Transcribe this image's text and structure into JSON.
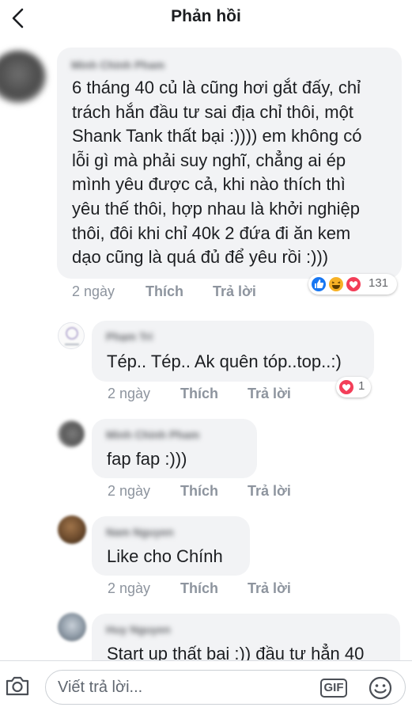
{
  "header": {
    "title": "Phản hồi"
  },
  "comments": [
    {
      "name": "Minh Chinh Pham",
      "lines": [
        "6 tháng 40 củ là cũng hơi gắt đấy, chỉ",
        "trách hắn đầu tư sai địa chỉ thôi, một",
        "Shank Tank thất bại :)))) em không có",
        "lỗi gì mà phải suy nghĩ, chẳng ai ép",
        "mình yêu được cả, khi nào thích thì",
        "yêu thế thôi, hợp nhau là khởi nghiệp",
        "thôi, đôi khi chỉ 40k 2 đứa đi ăn kem",
        "dạo cũng là quá đủ để yêu rồi :)))"
      ],
      "time": "2 ngày",
      "like": "Thích",
      "reply": "Trả lời",
      "reaction_count": "131",
      "reaction_types": [
        "like-icon",
        "haha-icon",
        "love-icon"
      ]
    },
    {
      "name": "Phạm Trí",
      "lines": [
        "Tép.. Tép.. Ak quên tóp..top..:)"
      ],
      "time": "2 ngày",
      "like": "Thích",
      "reply": "Trả lời",
      "reaction_count": "1",
      "reaction_types": [
        "love-icon"
      ]
    },
    {
      "name": "Minh Chinh Pham",
      "lines": [
        "fap fap :)))"
      ],
      "time": "2 ngày",
      "like": "Thích",
      "reply": "Trả lời"
    },
    {
      "name": "Nam Nguyen",
      "lines": [
        "Like cho Chính"
      ],
      "time": "2 ngày",
      "like": "Thích",
      "reply": "Trả lời"
    },
    {
      "name": "Huy Nguyen",
      "lines": [
        "Start up thất bại :)) đầu tư hẳn 40"
      ]
    }
  ],
  "composer": {
    "placeholder": "Viết trả lời...",
    "gif_label": "GIF",
    "camera_icon": "camera-icon",
    "emoji_icon": "emoji-icon"
  },
  "colors": {
    "bubble": "#f2f3f5",
    "like_blue": "#1877f2",
    "love_red": "#f33e58",
    "haha_yellow": "#f7b125",
    "meta_gray": "#8d949e"
  }
}
